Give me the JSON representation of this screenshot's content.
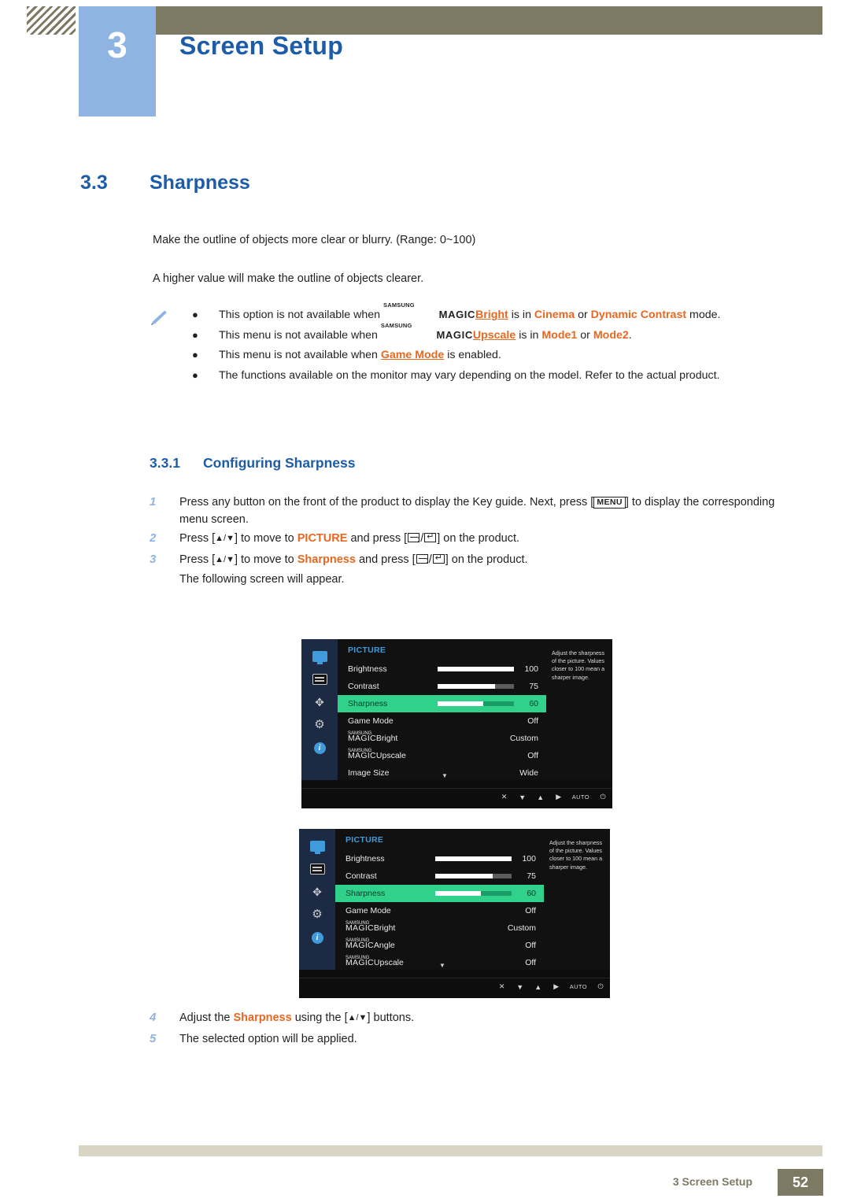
{
  "header": {
    "chapter_number": "3",
    "chapter_title": "Screen Setup"
  },
  "section": {
    "number": "3.3",
    "title": "Sharpness"
  },
  "intro": {
    "line1": "Make the outline of objects more clear or blurry. (Range: 0~100)",
    "line2": "A higher value will make the outline of objects clearer."
  },
  "notes": [
    {
      "pre": "This option is not available when ",
      "magic_sup": "SAMSUNG",
      "magic_main": "MAGIC",
      "magic_word": "Bright",
      "mid": " is in ",
      "opt1": "Cinema",
      "or": " or ",
      "opt2": "Dynamic Contrast",
      "post": " mode."
    },
    {
      "pre": "This menu is not available when ",
      "magic_sup": "SAMSUNG",
      "magic_main": "MAGIC",
      "magic_word": "Upscale",
      "mid": " is in ",
      "opt1": "Mode1",
      "or": " or ",
      "opt2": "Mode2",
      "post": "."
    },
    {
      "pre": "This menu is not available when ",
      "link": "Game Mode",
      "post": " is enabled."
    },
    {
      "plain": "The functions available on the monitor may vary depending on the model. Refer to the actual product."
    }
  ],
  "subsection": {
    "number": "3.3.1",
    "title": "Configuring Sharpness"
  },
  "steps": [
    {
      "num": "1",
      "pre": "Press any button on the front of the product to display the Key guide. Next, press [",
      "key": "MENU",
      "post": "] to display the corresponding menu screen."
    },
    {
      "num": "2",
      "pre": "Press [",
      "keys": "▲/▼",
      "mid": "] to move to ",
      "target": "PICTURE",
      "post": " and press [",
      "tail": "] on the product."
    },
    {
      "num": "3",
      "pre": "Press [",
      "keys": "▲/▼",
      "mid": "] to move to ",
      "target": "Sharpness",
      "post": " and press [",
      "tail": "] on the product.",
      "substep": "The following screen will appear."
    }
  ],
  "steps_after": [
    {
      "num": "4",
      "pre": "Adjust the ",
      "target": "Sharpness",
      "mid": " using the [",
      "keys": "▲/▼",
      "post": "] buttons."
    },
    {
      "num": "5",
      "plain": "The selected option will be applied."
    }
  ],
  "osd_common": {
    "menu_title": "PICTURE",
    "description": "Adjust the sharpness of the picture. Values closer to 100 mean a sharper image.",
    "footer_keys": [
      "✕",
      "▼",
      "▲",
      "▶",
      "AUTO",
      "⏻"
    ],
    "rail_icons": [
      "monitor-icon",
      "lines-icon",
      "arrows-icon",
      "gear-icon",
      "info-icon"
    ],
    "magic_sup": "SAMSUNG",
    "magic_main": "MAGIC"
  },
  "osd1": {
    "rows": [
      {
        "label": "Brightness",
        "value": "100",
        "bar": 100
      },
      {
        "label": "Contrast",
        "value": "75",
        "bar": 75
      },
      {
        "label": "Sharpness",
        "value": "60",
        "bar": 60,
        "highlight": true
      },
      {
        "label": "Game Mode",
        "value": "Off"
      },
      {
        "label": "Bright",
        "value": "Custom",
        "magic": true
      },
      {
        "label": "Upscale",
        "value": "Off",
        "magic": true
      },
      {
        "label": "Image Size",
        "value": "Wide"
      }
    ]
  },
  "osd2": {
    "rows": [
      {
        "label": "Brightness",
        "value": "100",
        "bar": 100
      },
      {
        "label": "Contrast",
        "value": "75",
        "bar": 75
      },
      {
        "label": "Sharpness",
        "value": "60",
        "bar": 60,
        "highlight": true
      },
      {
        "label": "Game Mode",
        "value": "Off"
      },
      {
        "label": "Bright",
        "value": "Custom",
        "magic": true
      },
      {
        "label": "Angle",
        "value": "Off",
        "magic": true
      },
      {
        "label": "Upscale",
        "value": "Off",
        "magic": true
      }
    ]
  },
  "footer": {
    "text": "3 Screen Setup",
    "page": "52"
  }
}
